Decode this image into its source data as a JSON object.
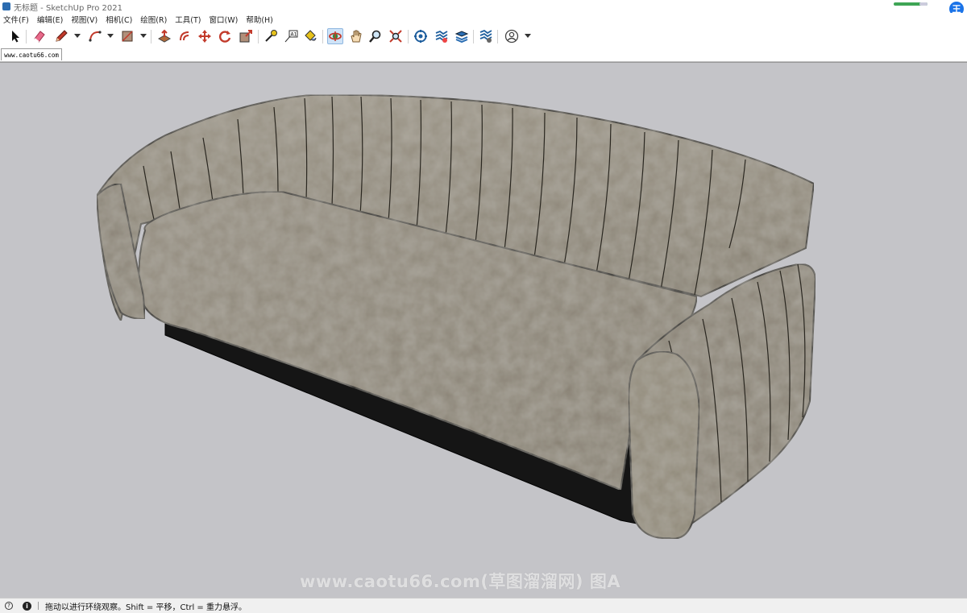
{
  "window": {
    "title": "无标题 - SketchUp Pro 2021",
    "user_badge": "王",
    "progress_fraction": 0.75
  },
  "menu": [
    "文件(F)",
    "编辑(E)",
    "视图(V)",
    "相机(C)",
    "绘图(R)",
    "工具(T)",
    "窗口(W)",
    "帮助(H)"
  ],
  "toolbar": {
    "tools": [
      {
        "name": "select-icon"
      },
      {
        "name": "eraser-icon"
      },
      {
        "name": "pencil-icon"
      },
      {
        "name": "arc-icon"
      },
      {
        "name": "rectangle-icon"
      },
      {
        "name": "push-pull-icon"
      },
      {
        "name": "offset-icon"
      },
      {
        "name": "move-icon"
      },
      {
        "name": "rotate-icon"
      },
      {
        "name": "scale-icon"
      },
      {
        "name": "tape-measure-icon"
      },
      {
        "name": "text-icon"
      },
      {
        "name": "paint-bucket-icon"
      },
      {
        "name": "orbit-icon"
      },
      {
        "name": "pan-icon"
      },
      {
        "name": "zoom-icon"
      },
      {
        "name": "zoom-extents-icon"
      },
      {
        "name": "warehouse-icon"
      },
      {
        "name": "extension-warehouse-icon"
      },
      {
        "name": "layout-icon"
      },
      {
        "name": "extension-manager-icon"
      },
      {
        "name": "account-icon"
      }
    ],
    "active_tool": "orbit-icon"
  },
  "scene_tab": {
    "label": "www.caotu66.com"
  },
  "viewport": {
    "background": "#c4c4c8",
    "watermark": "www.caotu66.com(草图溜溜网) 图A",
    "fabric_color": "#8f887a",
    "base_color": "#1a1a1a"
  },
  "status": {
    "text": "拖动以进行环绕观察。Shift = 平移，Ctrl = 重力悬浮。"
  }
}
